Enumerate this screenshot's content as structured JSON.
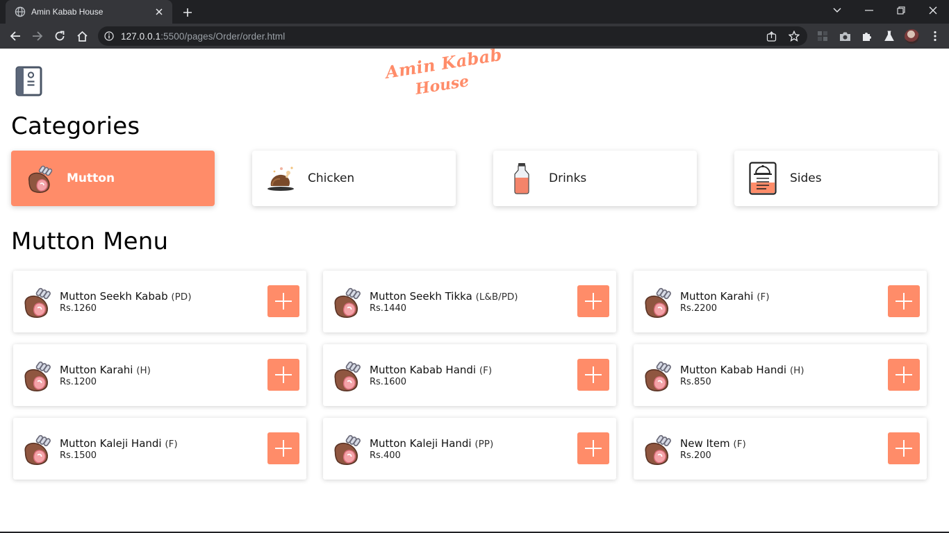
{
  "browser": {
    "tab_title": "Amin Kabab House",
    "url_host": "127.0.0.1",
    "url_rest": ":5500/pages/Order/order.html"
  },
  "header": {
    "logo_line1": "Amin Kabab",
    "logo_line2": "House"
  },
  "categories": {
    "title": "Categories",
    "items": [
      {
        "label": "Mutton",
        "icon": "mutton-icon",
        "active": true
      },
      {
        "label": "Chicken",
        "icon": "chicken-icon",
        "active": false
      },
      {
        "label": "Drinks",
        "icon": "drink-bottle-icon",
        "active": false
      },
      {
        "label": "Sides",
        "icon": "sides-menu-icon",
        "active": false
      }
    ]
  },
  "menu": {
    "title": "Mutton Menu",
    "items": [
      {
        "name": "Mutton Seekh Kabab",
        "tag": "(PD)",
        "price": "Rs.1260"
      },
      {
        "name": "Mutton Seekh Tikka",
        "tag": "(L&B/PD)",
        "price": "Rs.1440"
      },
      {
        "name": "Mutton Karahi",
        "tag": "(F)",
        "price": "Rs.2200"
      },
      {
        "name": "Mutton Karahi",
        "tag": "(H)",
        "price": "Rs.1200"
      },
      {
        "name": "Mutton Kabab Handi",
        "tag": "(F)",
        "price": "Rs.1600"
      },
      {
        "name": "Mutton Kabab Handi",
        "tag": "(H)",
        "price": "Rs.850"
      },
      {
        "name": "Mutton Kaleji Handi",
        "tag": "(F)",
        "price": "Rs.1500"
      },
      {
        "name": "Mutton Kaleji Handi",
        "tag": "(PP)",
        "price": "Rs.400"
      },
      {
        "name": "New Item",
        "tag": "(F)",
        "price": "Rs.200"
      }
    ]
  },
  "colors": {
    "accent": "#ff8c69",
    "browser_dark": "#202124",
    "browser_toolbar": "#35363a"
  }
}
